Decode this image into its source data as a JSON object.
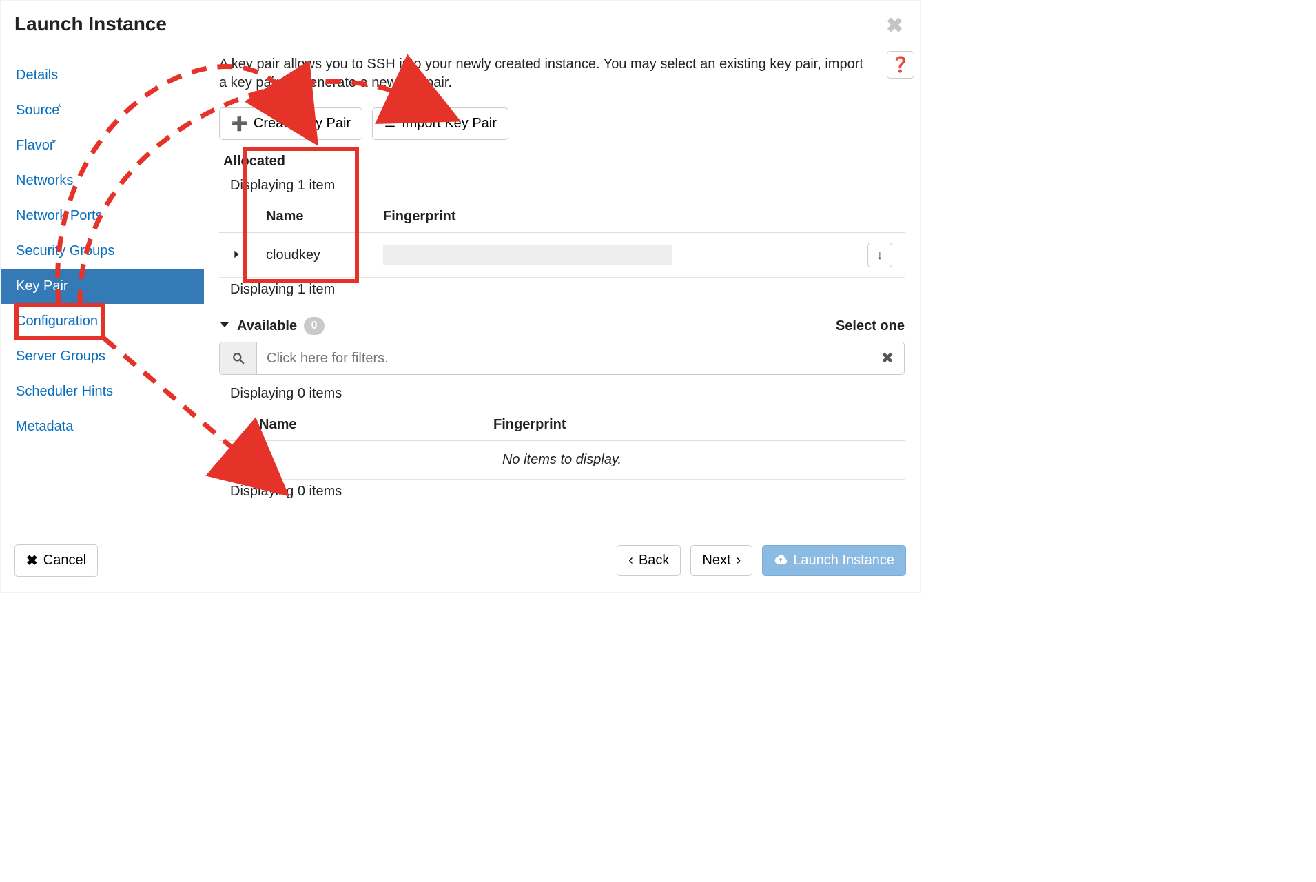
{
  "header": {
    "title": "Launch Instance"
  },
  "sidebar": {
    "items": [
      {
        "label": "Details",
        "required": false
      },
      {
        "label": "Source",
        "required": true
      },
      {
        "label": "Flavor",
        "required": true
      },
      {
        "label": "Networks",
        "required": false
      },
      {
        "label": "Network Ports",
        "required": false
      },
      {
        "label": "Security Groups",
        "required": false
      },
      {
        "label": "Key Pair",
        "required": false,
        "active": true
      },
      {
        "label": "Configuration",
        "required": false
      },
      {
        "label": "Server Groups",
        "required": false
      },
      {
        "label": "Scheduler Hints",
        "required": false
      },
      {
        "label": "Metadata",
        "required": false
      }
    ]
  },
  "main": {
    "intro": "A key pair allows you to SSH into your newly created instance. You may select an existing key pair, import a key pair, or generate a new key pair.",
    "create_btn": "Create Key Pair",
    "import_btn": "Import Key Pair",
    "allocated": {
      "label": "Allocated",
      "display_top": "Displaying 1 item",
      "display_bottom": "Displaying 1 item",
      "columns": {
        "name": "Name",
        "fingerprint": "Fingerprint"
      },
      "rows": [
        {
          "name": "cloudkey",
          "fingerprint": ""
        }
      ]
    },
    "available": {
      "label": "Available",
      "count": "0",
      "select_one": "Select one",
      "filter_placeholder": "Click here for filters.",
      "display_top": "Displaying 0 items",
      "display_bottom": "Displaying 0 items",
      "columns": {
        "name": "Name",
        "fingerprint": "Fingerprint"
      },
      "empty": "No items to display."
    }
  },
  "footer": {
    "cancel": "Cancel",
    "back": "Back",
    "next": "Next",
    "launch": "Launch Instance"
  }
}
